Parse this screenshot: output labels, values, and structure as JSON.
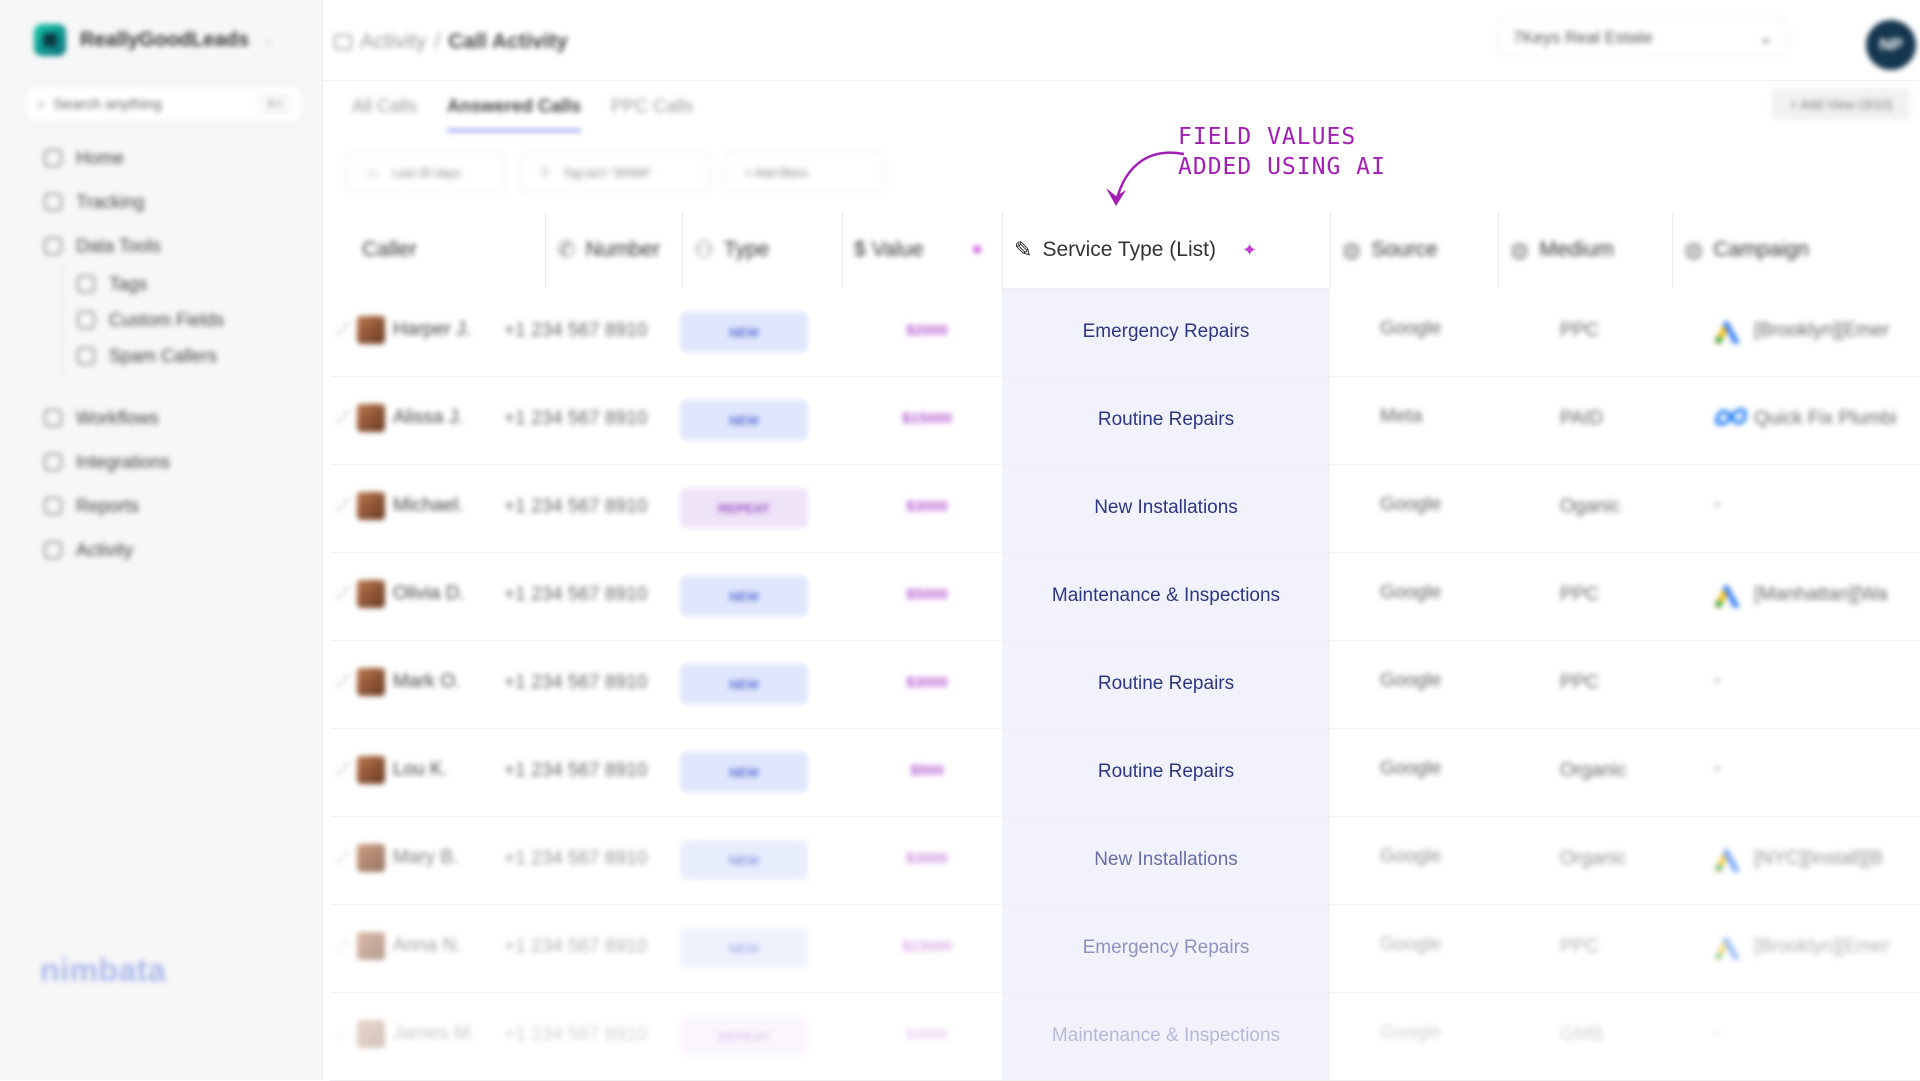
{
  "app": {
    "brand_name": "ReallyGoodLeads",
    "search_placeholder": "Search anything",
    "search_shortcut": "⌘K",
    "footer_brand": "nimbata"
  },
  "sidebar": {
    "items": [
      {
        "label": "Home",
        "icon": "home-icon"
      },
      {
        "label": "Tracking",
        "icon": "tracking-icon"
      },
      {
        "label": "Data Tools",
        "icon": "data-tools-icon"
      }
    ],
    "sub_items": [
      {
        "label": "Tags",
        "icon": "tag-icon"
      },
      {
        "label": "Custom Fields",
        "icon": "custom-fields-icon"
      },
      {
        "label": "Spam Callers",
        "icon": "spam-icon"
      }
    ],
    "items2": [
      {
        "label": "Workflows",
        "icon": "workflow-icon"
      },
      {
        "label": "Integrations",
        "icon": "integrations-icon"
      },
      {
        "label": "Reports",
        "icon": "reports-icon"
      },
      {
        "label": "Activity",
        "icon": "activity-icon"
      }
    ]
  },
  "header": {
    "crumb_parent": "Activity",
    "crumb_sep": "/",
    "crumb_current": "Call Activity",
    "account": "7Keys Real Estate",
    "avatar_initials": "NP"
  },
  "tabs": [
    {
      "label": "All Calls",
      "active": false
    },
    {
      "label": "Answered Calls",
      "active": true
    },
    {
      "label": "PPC Calls",
      "active": false
    }
  ],
  "add_view_label": "+ Add View (3/10)",
  "filters": [
    {
      "label": "Last 30 days",
      "icon": "calendar-icon"
    },
    {
      "label": "Tag isn't \"SPAM\"",
      "icon": "filter-icon"
    },
    {
      "label": "+ Add filters",
      "icon": ""
    }
  ],
  "annotation": {
    "line1": "FIELD VALUES",
    "line2": "ADDED USING AI"
  },
  "table": {
    "columns": [
      {
        "label": "Caller",
        "icon": ""
      },
      {
        "label": "Number",
        "icon": "phone-icon"
      },
      {
        "label": "Type",
        "icon": "users-icon"
      },
      {
        "label": "$ Value",
        "icon": "sparkle-icon"
      },
      {
        "label": "Service Type (List)",
        "icon": "edit-icon"
      },
      {
        "label": "Source",
        "icon": "globe-icon"
      },
      {
        "label": "Medium",
        "icon": "globe-icon"
      },
      {
        "label": "Campaign",
        "icon": "globe-icon"
      }
    ],
    "rows": [
      {
        "caller": "Harper J.",
        "number": "+1 234 567 8910",
        "type": "NEW",
        "value": "$2000",
        "service": "Emergency Repairs",
        "source": "Google",
        "medium": "PPC",
        "campaign": "[Brooklyn][Emer",
        "campaign_icon": "google-ads-icon"
      },
      {
        "caller": "Alissa J.",
        "number": "+1 234 567 8910",
        "type": "NEW",
        "value": "$15000",
        "service": "Routine Repairs",
        "source": "Meta",
        "medium": "PAID",
        "campaign": "Quick Fix Plumbi",
        "campaign_icon": "meta-icon"
      },
      {
        "caller": "Michael.",
        "number": "+1 234 567 8910",
        "type": "REPEAT",
        "value": "$3000",
        "service": "New Installations",
        "source": "Google",
        "medium": "Oganic",
        "campaign": "-",
        "campaign_icon": ""
      },
      {
        "caller": "Olivia D.",
        "number": "+1 234 567 8910",
        "type": "NEW",
        "value": "$5000",
        "service": "Maintenance & Inspections",
        "source": "Google",
        "medium": "PPC",
        "campaign": "[Manhattan][Wa",
        "campaign_icon": "google-ads-icon"
      },
      {
        "caller": "Mark O.",
        "number": "+1 234 567 8910",
        "type": "NEW",
        "value": "$3000",
        "service": "Routine Repairs",
        "source": "Google",
        "medium": "PPC",
        "campaign": "-",
        "campaign_icon": ""
      },
      {
        "caller": "Lou K.",
        "number": "+1 234 567 8910",
        "type": "NEW",
        "value": "$500",
        "service": "Routine Repairs",
        "source": "Google",
        "medium": "Organic",
        "campaign": "-",
        "campaign_icon": ""
      },
      {
        "caller": "Mary B.",
        "number": "+1 234 567 8910",
        "type": "NEW",
        "value": "$3000",
        "service": "New Installations",
        "source": "Google",
        "medium": "Organic",
        "campaign": "[NYC][Install][B",
        "campaign_icon": "google-ads-icon"
      },
      {
        "caller": "Anna N.",
        "number": "+1 234 567 8910",
        "type": "NEW",
        "value": "$23000",
        "service": "Emergency Repairs",
        "source": "Google",
        "medium": "PPC",
        "campaign": "[Brooklyn][Emer",
        "campaign_icon": "google-ads-icon"
      },
      {
        "caller": "James M.",
        "number": "+1 234 567 8910",
        "type": "REPEAT",
        "value": "$3000",
        "service": "Maintenance & Inspections",
        "source": "Google",
        "medium": "GMB",
        "campaign": "-",
        "campaign_icon": ""
      }
    ]
  }
}
